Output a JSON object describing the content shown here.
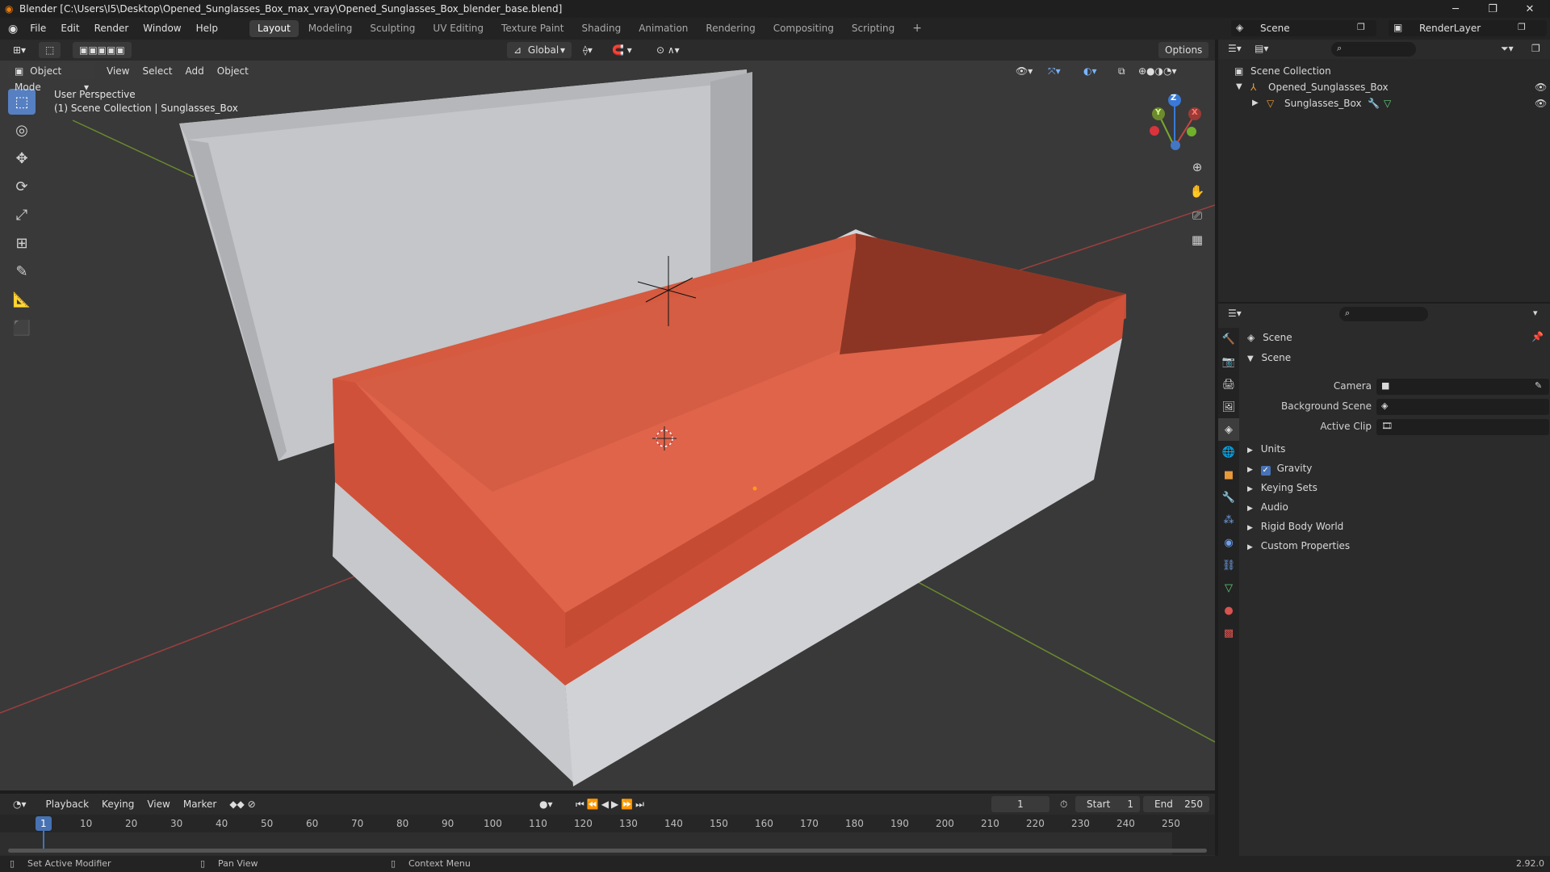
{
  "window": {
    "title": "Blender [C:\\Users\\I5\\Desktop\\Opened_Sunglasses_Box_max_vray\\Opened_Sunglasses_Box_blender_base.blend]"
  },
  "menu": {
    "items": [
      "File",
      "Edit",
      "Render",
      "Window",
      "Help"
    ]
  },
  "workspaces": {
    "tabs": [
      "Layout",
      "Modeling",
      "Sculpting",
      "UV Editing",
      "Texture Paint",
      "Shading",
      "Animation",
      "Rendering",
      "Compositing",
      "Scripting"
    ],
    "active": "Layout"
  },
  "topright": {
    "scene": "Scene",
    "render_layer": "RenderLayer"
  },
  "viewport_header": {
    "transform_orientation": "Global",
    "options": "Options",
    "mode": "Object Mode",
    "menus": [
      "View",
      "Select",
      "Add",
      "Object"
    ]
  },
  "viewport": {
    "perspective": "User Perspective",
    "collection_info": "(1) Scene Collection | Sunglasses_Box",
    "gizmo": {
      "x": "X",
      "y": "Y",
      "z": "Z"
    }
  },
  "outliner": {
    "root": "Scene Collection",
    "items": [
      {
        "name": "Opened_Sunglasses_Box"
      },
      {
        "name": "Sunglasses_Box"
      }
    ]
  },
  "properties": {
    "context": "Scene",
    "panel": "Scene",
    "fields": {
      "camera_label": "Camera",
      "background_label": "Background Scene",
      "clip_label": "Active Clip"
    },
    "sections": [
      "Units",
      "Gravity",
      "Keying Sets",
      "Audio",
      "Rigid Body World",
      "Custom Properties"
    ]
  },
  "timeline": {
    "menus": [
      "Playback",
      "Keying",
      "View",
      "Marker"
    ],
    "current_frame": "1",
    "start_label": "Start",
    "start": "1",
    "end_label": "End",
    "end": "250",
    "ticks": [
      "1",
      "10",
      "20",
      "30",
      "40",
      "50",
      "60",
      "70",
      "80",
      "90",
      "100",
      "110",
      "120",
      "130",
      "140",
      "150",
      "160",
      "170",
      "180",
      "190",
      "200",
      "210",
      "220",
      "230",
      "240",
      "250"
    ]
  },
  "status": {
    "left": "Set Active Modifier",
    "mid": "Pan View",
    "right": "Context Menu",
    "version": "2.92.0"
  },
  "colors": {
    "accent": "#5680c2",
    "box_red": "#d9563c",
    "box_gray": "#c8cacd"
  }
}
